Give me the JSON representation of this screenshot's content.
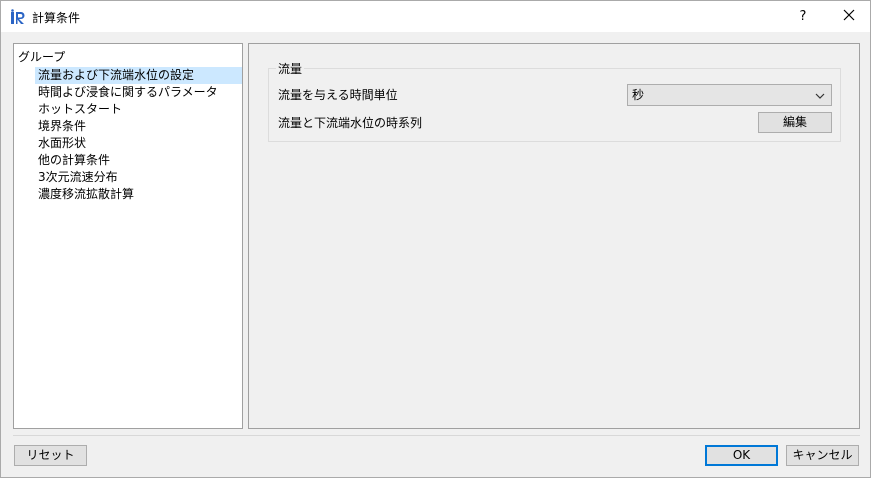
{
  "window": {
    "title": "計算条件",
    "help_label": "?",
    "icon": "irc-app-icon"
  },
  "tree": {
    "root_label": "グループ",
    "items": [
      {
        "label": "流量および下流端水位の設定",
        "selected": true
      },
      {
        "label": "時間よび浸食に関するパラメータ"
      },
      {
        "label": "ホットスタート"
      },
      {
        "label": "境界条件"
      },
      {
        "label": "水面形状"
      },
      {
        "label": "他の計算条件"
      },
      {
        "label": "3次元流速分布"
      },
      {
        "label": "濃度移流拡散計算"
      }
    ]
  },
  "panel": {
    "group_title": "流量",
    "time_unit_label": "流量を与える時間単位",
    "time_unit_value": "秒",
    "series_label": "流量と下流端水位の時系列",
    "edit_button": "編集"
  },
  "footer": {
    "reset_button": "リセット",
    "ok_button": "OK",
    "cancel_button": "キャンセル"
  },
  "colors": {
    "selection": "#cce8ff",
    "accent": "#0078d7"
  }
}
